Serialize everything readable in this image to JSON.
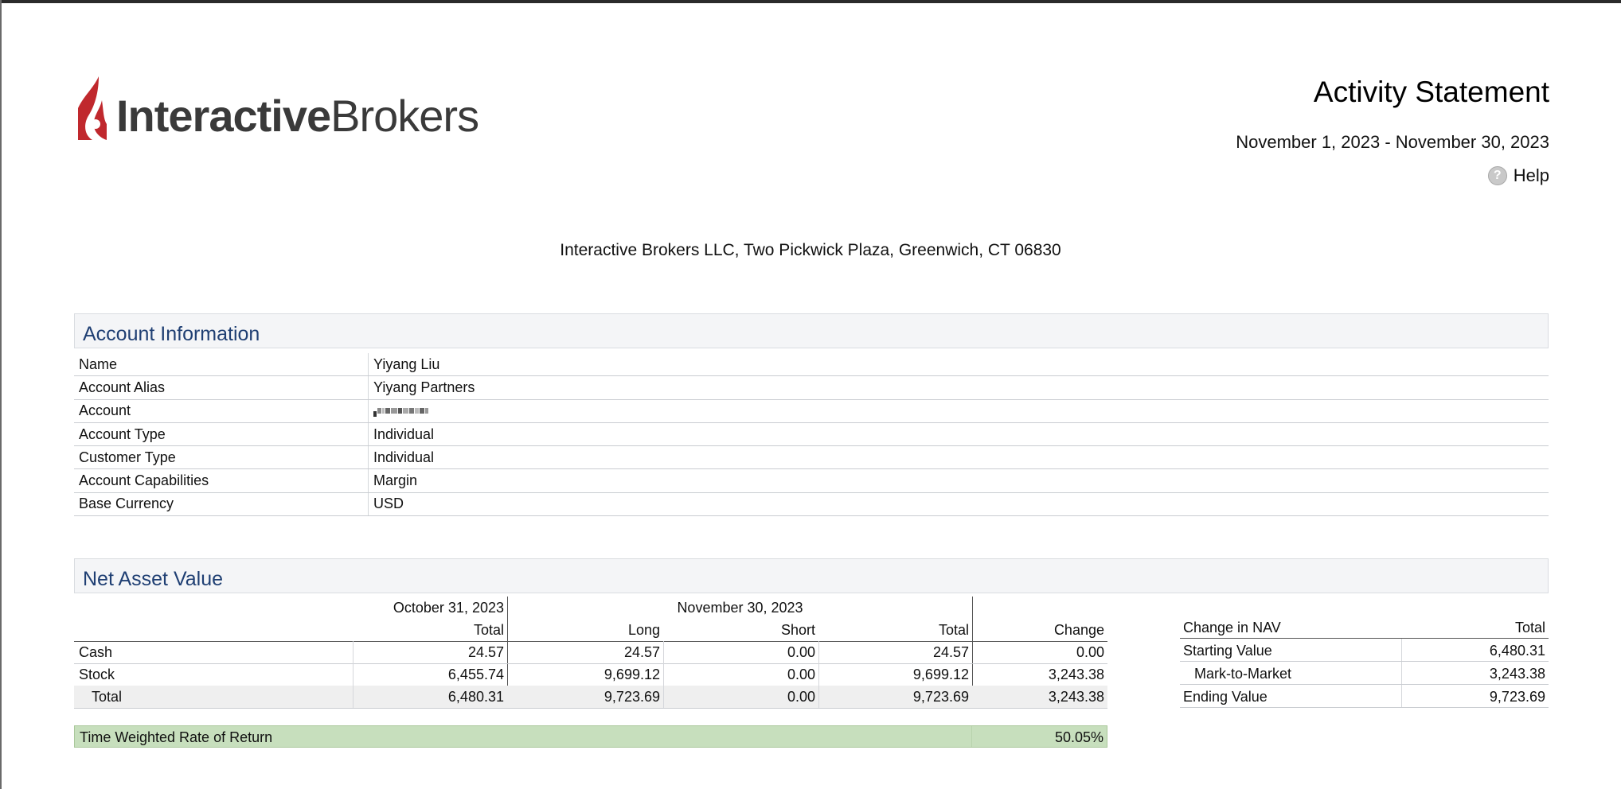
{
  "header": {
    "logo_bold": "Interactive",
    "logo_regular": "Brokers",
    "title": "Activity Statement",
    "period": "November 1, 2023 - November 30, 2023",
    "help_label": "Help",
    "help_icon": "question-circle-icon",
    "address": "Interactive Brokers LLC, Two Pickwick Plaza, Greenwich, CT 06830"
  },
  "account_info": {
    "title": "Account Information",
    "rows": [
      {
        "label": "Name",
        "value": "Yiyang Liu"
      },
      {
        "label": "Account Alias",
        "value": "Yiyang Partners"
      },
      {
        "label": "Account",
        "value": ""
      },
      {
        "label": "Account Type",
        "value": "Individual"
      },
      {
        "label": "Customer Type",
        "value": "Individual"
      },
      {
        "label": "Account Capabilities",
        "value": "Margin"
      },
      {
        "label": "Base Currency",
        "value": "USD"
      }
    ]
  },
  "nav": {
    "title": "Net Asset Value",
    "prior_date": "October 31, 2023",
    "current_date": "November 30, 2023",
    "col_total": "Total",
    "col_long": "Long",
    "col_short": "Short",
    "col_total2": "Total",
    "col_change": "Change",
    "rows": [
      {
        "label": "Cash",
        "prior_total": "24.57",
        "long": "24.57",
        "short": "0.00",
        "total": "24.57",
        "change": "0.00"
      },
      {
        "label": "Stock",
        "prior_total": "6,455.74",
        "long": "9,699.12",
        "short": "0.00",
        "total": "9,699.12",
        "change": "3,243.38"
      },
      {
        "label": "Total",
        "prior_total": "6,480.31",
        "long": "9,723.69",
        "short": "0.00",
        "total": "9,723.69",
        "change": "3,243.38"
      }
    ],
    "twr_label": "Time Weighted Rate of Return",
    "twr_value": "50.05%"
  },
  "change_in_nav": {
    "header_label": "Change in NAV",
    "header_total": "Total",
    "rows": [
      {
        "label": "Starting Value",
        "value": "6,480.31"
      },
      {
        "label": "Mark-to-Market",
        "value": "3,243.38"
      },
      {
        "label": "Ending Value",
        "value": "9,723.69"
      }
    ]
  },
  "colors": {
    "section_title": "#1f3f73",
    "logo_red": "#c0282d",
    "twr_bg": "#c7dfbd",
    "total_row_bg": "#efefef"
  }
}
